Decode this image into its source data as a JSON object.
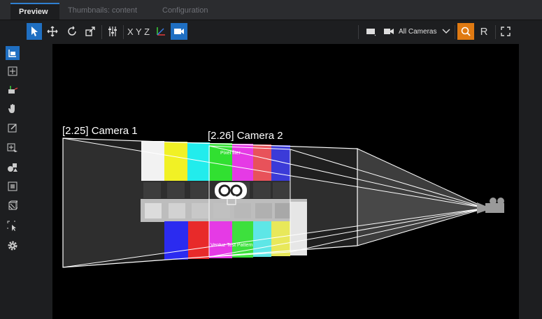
{
  "tabs": [
    {
      "label": "Preview",
      "active": true
    },
    {
      "label": "Thumbnails: content",
      "active": false
    },
    {
      "label": "Configuration",
      "active": false
    }
  ],
  "toolbar": {
    "axes_label": "X Y Z",
    "camera_selector": "All Cameras",
    "r_label": "R"
  },
  "viewport": {
    "cameras": [
      {
        "label": "[2.25] Camera 1"
      },
      {
        "label": "[2.26] Camera 2"
      }
    ],
    "card_text_top": "Pixel fiter",
    "card_text_bottom": "Ventuz Test Pattern"
  },
  "colors": {
    "accent": "#1f6fc2",
    "search_active": "#e07a12",
    "bars_top": [
      "#f2f2f2",
      "#f1f125",
      "#22ecec",
      "#31e031",
      "#e53ae5",
      "#e8525a",
      "#3b3bd8"
    ],
    "bars_bottom": [
      "#2b2bf0",
      "#e82a2a",
      "#e53ae5",
      "#3de03d",
      "#5ee6e6",
      "#e8e85a",
      "#e6e6e6"
    ]
  },
  "icons": [
    "select-arrow-icon",
    "move-icon",
    "rotate-icon",
    "scale-icon",
    "sliders-icon",
    "axis-gizmo-icon",
    "camera-icon",
    "monitor-icon",
    "video-camera-icon",
    "chevron-down-icon",
    "search-icon",
    "fullscreen-icon",
    "settings-gear-icon"
  ]
}
